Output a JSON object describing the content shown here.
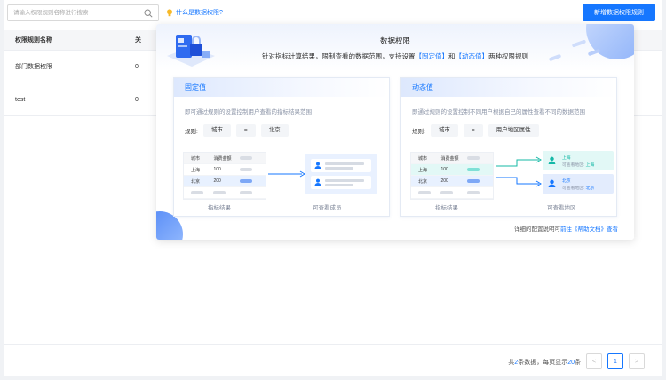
{
  "toolbar": {
    "search_placeholder": "请输入权限规则名称进行搜索",
    "help_link": "什么是数据权限?",
    "add_button": "新增数据权限规则"
  },
  "table": {
    "columns": [
      "权限规则名称",
      "关"
    ],
    "rows": [
      {
        "name": "部门数据权限",
        "col2": "0"
      },
      {
        "name": "test",
        "col2": "0"
      }
    ]
  },
  "pagination": {
    "total_prefix": "共",
    "total": "2",
    "total_mid": "条数据，每页显示",
    "page_size": "20",
    "total_suffix": "条",
    "prev": "<",
    "current_page": "1",
    "next": ">"
  },
  "popover": {
    "title": "数据权限",
    "subtitle_1": "针对指标计算结果，限制查看的数据范围，支持设置",
    "subtitle_fixed": "【固定值】",
    "subtitle_and": "和",
    "subtitle_dynamic": "【动态值】",
    "subtitle_2": "两种权限规则",
    "fixed": {
      "title": "固定值",
      "desc": "即可通过规则的设置控制用户查看的指标结果范围",
      "rule_label": "规则:",
      "rule_field": "城市",
      "rule_op": "=",
      "rule_value": "北京",
      "table_head": [
        "城市",
        "消费金额"
      ],
      "table_rows": [
        [
          "上海",
          "100"
        ],
        [
          "北京",
          "200"
        ]
      ],
      "caption_left": "指标结果",
      "caption_right": "可查看成员"
    },
    "dynamic": {
      "title": "动态值",
      "desc": "即通过规则的设置控制不同用户根据自己的属性查看不同的数据范围",
      "rule_label": "规则:",
      "rule_field": "城市",
      "rule_op": "=",
      "rule_value": "用户地区属性",
      "table_head": [
        "城市",
        "消费金额"
      ],
      "table_rows": [
        [
          "上海",
          "100"
        ],
        [
          "北京",
          "200"
        ]
      ],
      "region_1": {
        "city": "上海",
        "label": "可查看地区:",
        "value": "上海"
      },
      "region_2": {
        "city": "北京",
        "label": "可查看地区:",
        "value": "北京"
      },
      "caption_left": "指标结果",
      "caption_right": "可查看地区"
    },
    "footer_prefix": "详细的配置说明可",
    "footer_link": "前往《帮助文档》查看"
  },
  "colors": {
    "primary": "#1677ff",
    "teal": "#14b8a6"
  }
}
